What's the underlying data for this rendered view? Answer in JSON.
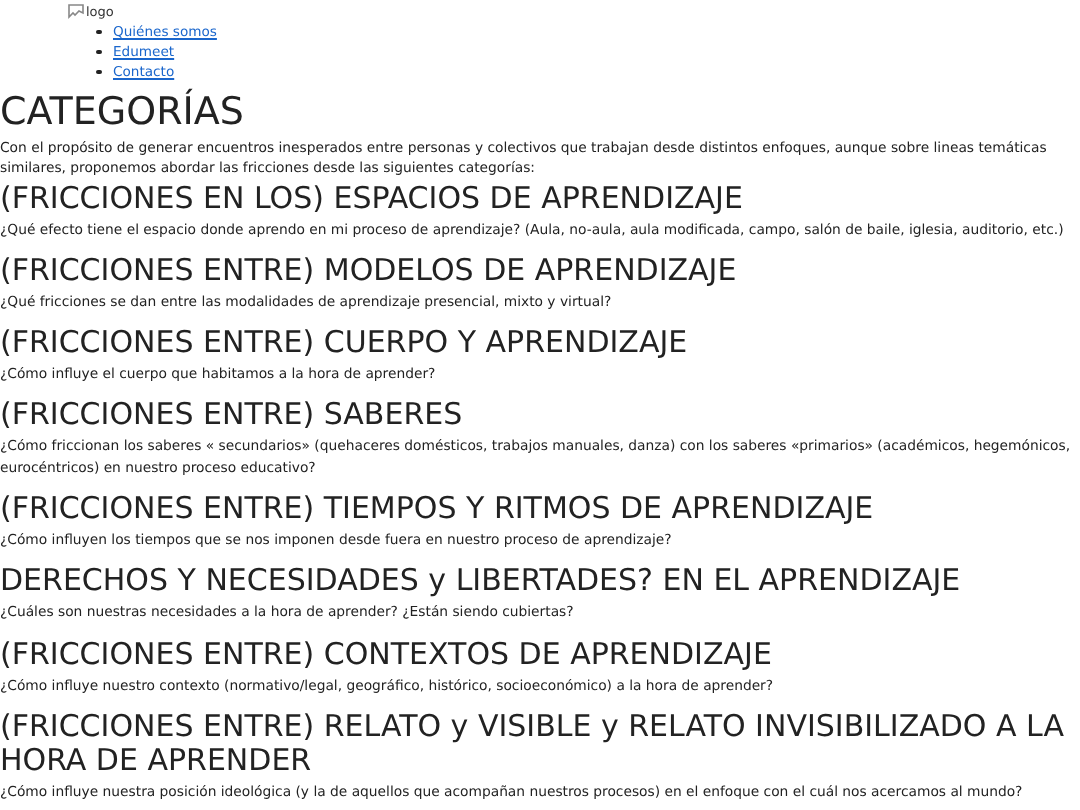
{
  "logo": {
    "alt_text": "logo"
  },
  "nav": [
    "Quiénes somos",
    "Edumeet",
    "Contacto"
  ],
  "title": "CATEGORÍAS",
  "intro": "Con el propósito de generar encuentros inesperados entre personas y colectivos que trabajan desde distintos enfoques, aunque sobre lineas temáticas similares, proponemos abordar las fricciones desde las siguientes categorías:",
  "categories": [
    {
      "heading": "(FRICCIONES EN LOS) ESPACIOS DE APRENDIZAJE",
      "question": "¿Qué efecto tiene el espacio donde aprendo en mi proceso de aprendizaje? (Aula, no-aula, aula modificada, campo, salón de baile, iglesia, auditorio, etc.)"
    },
    {
      "heading": "(FRICCIONES ENTRE) MODELOS DE APRENDIZAJE",
      "question": "¿Qué fricciones se dan entre las modalidades de aprendizaje presencial, mixto y virtual?"
    },
    {
      "heading": "(FRICCIONES ENTRE) CUERPO Y APRENDIZAJE",
      "question": "¿Cómo influye el cuerpo que habitamos a la hora de aprender?"
    },
    {
      "heading": "(FRICCIONES ENTRE) SABERES",
      "question": "¿Cómo friccionan los saberes « secundarios» (quehaceres domésticos, trabajos manuales, danza) con los saberes «primarios» (académicos, hegemónicos, eurocéntricos) en nuestro proceso educativo?"
    },
    {
      "heading": "(FRICCIONES ENTRE) TIEMPOS Y RITMOS DE APRENDIZAJE",
      "question": "¿Cómo influyen los tiempos que se nos imponen desde fuera en nuestro proceso de aprendizaje?"
    },
    {
      "heading": "DERECHOS Y NECESIDADES y LIBERTADES? EN EL APRENDIZAJE",
      "question": "¿Cuáles son nuestras necesidades a la hora de aprender? ¿Están siendo cubiertas?"
    },
    {
      "heading": "(FRICCIONES ENTRE) CONTEXTOS DE APRENDIZAJE",
      "question": "¿Cómo influye nuestro contexto (normativo/legal, geográfico, histórico, socioeconómico) a la hora de aprender?"
    },
    {
      "heading": "(FRICCIONES ENTRE) RELATO y VISIBLE y RELATO INVISIBILIZADO A LA HORA DE APRENDER",
      "question": "¿Cómo influye nuestra posición ideológica (y la de aquellos que acompañan nuestros procesos) en el enfoque con el cuál nos acercamos al mundo?"
    }
  ]
}
